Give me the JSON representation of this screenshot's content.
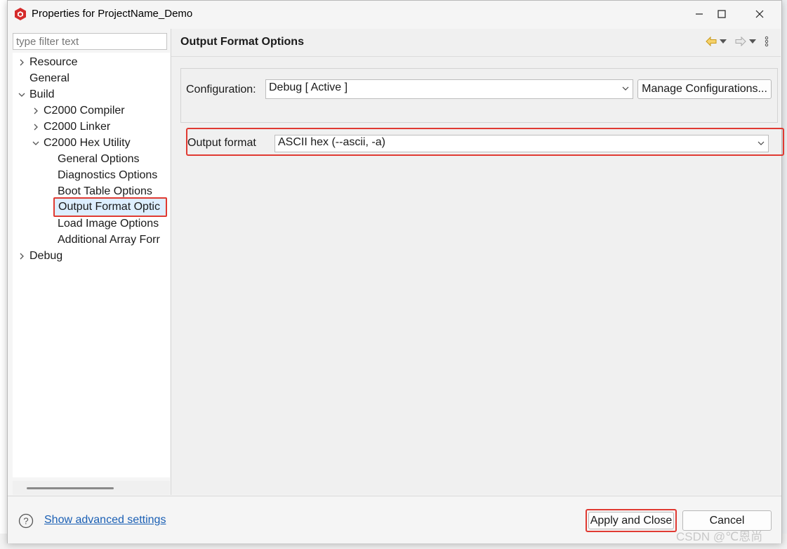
{
  "window": {
    "title": "Properties for ProjectName_Demo"
  },
  "filter": {
    "placeholder": "type filter text"
  },
  "tree": {
    "items": [
      {
        "label": "Resource"
      },
      {
        "label": "General"
      },
      {
        "label": "Build"
      },
      {
        "label": "C2000 Compiler"
      },
      {
        "label": "C2000 Linker"
      },
      {
        "label": "C2000 Hex Utility"
      },
      {
        "label": "General Options"
      },
      {
        "label": "Diagnostics Options"
      },
      {
        "label": "Boot Table Options"
      },
      {
        "label": "Output Format Optic"
      },
      {
        "label": "Load Image Options"
      },
      {
        "label": "Additional Array Forr"
      },
      {
        "label": "Debug"
      }
    ],
    "selected": "Output Format Options"
  },
  "page": {
    "title": "Output Format Options"
  },
  "configuration": {
    "label": "Configuration:",
    "value": "Debug  [ Active ]",
    "manage_button": "Manage Configurations..."
  },
  "output_format": {
    "label": "Output format",
    "value": "ASCII hex (--ascii, -a)"
  },
  "footer": {
    "advanced_link": "Show advanced settings",
    "apply_close": "Apply and Close",
    "cancel": "Cancel"
  },
  "watermark": "CSDN @℃恩尚",
  "colors": {
    "highlight": "#e03a32",
    "link": "#1a5fb4",
    "selection": "#ddeeff"
  }
}
